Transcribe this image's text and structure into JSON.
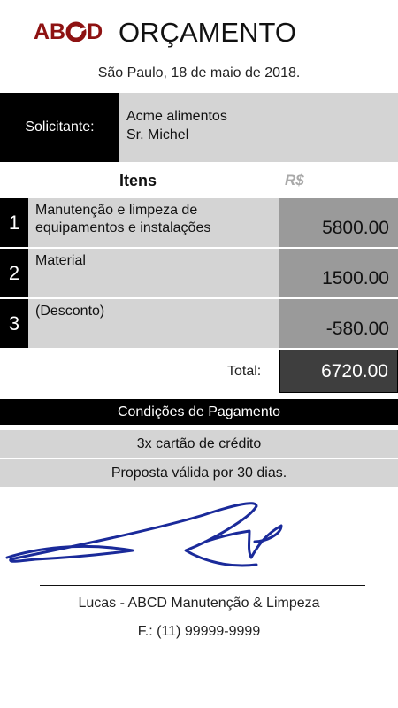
{
  "header": {
    "logo_left": "AB",
    "logo_right": "D",
    "title": "ORÇAMENTO"
  },
  "date": "São Paulo,  18 de maio de 2018.",
  "requester": {
    "label": "Solicitante:",
    "company": "Acme alimentos",
    "contact": "Sr. Michel"
  },
  "items": {
    "heading": "Itens",
    "currency": "R$",
    "rows": [
      {
        "num": "1",
        "line1": "Manutenção e limpeza de",
        "line2": "equipamentos e instalações",
        "value": "5800.00"
      },
      {
        "num": "2",
        "line1": "Material",
        "line2": "",
        "value": "1500.00"
      },
      {
        "num": "3",
        "line1": "(Desconto)",
        "line2": "",
        "value": "-580.00"
      }
    ],
    "total_label": "Total:",
    "total_value": "6720.00"
  },
  "payment": {
    "heading": "Condições de Pagamento",
    "condition": "3x cartão de crédito",
    "validity": "Proposta válida por 30 dias."
  },
  "footer": {
    "name": "Lucas - ABCD Manutenção & Limpeza",
    "phone": "F.: (11) 99999-9999"
  },
  "colors": {
    "brand": "#8e1212",
    "signature_ink": "#1a2a9a"
  }
}
